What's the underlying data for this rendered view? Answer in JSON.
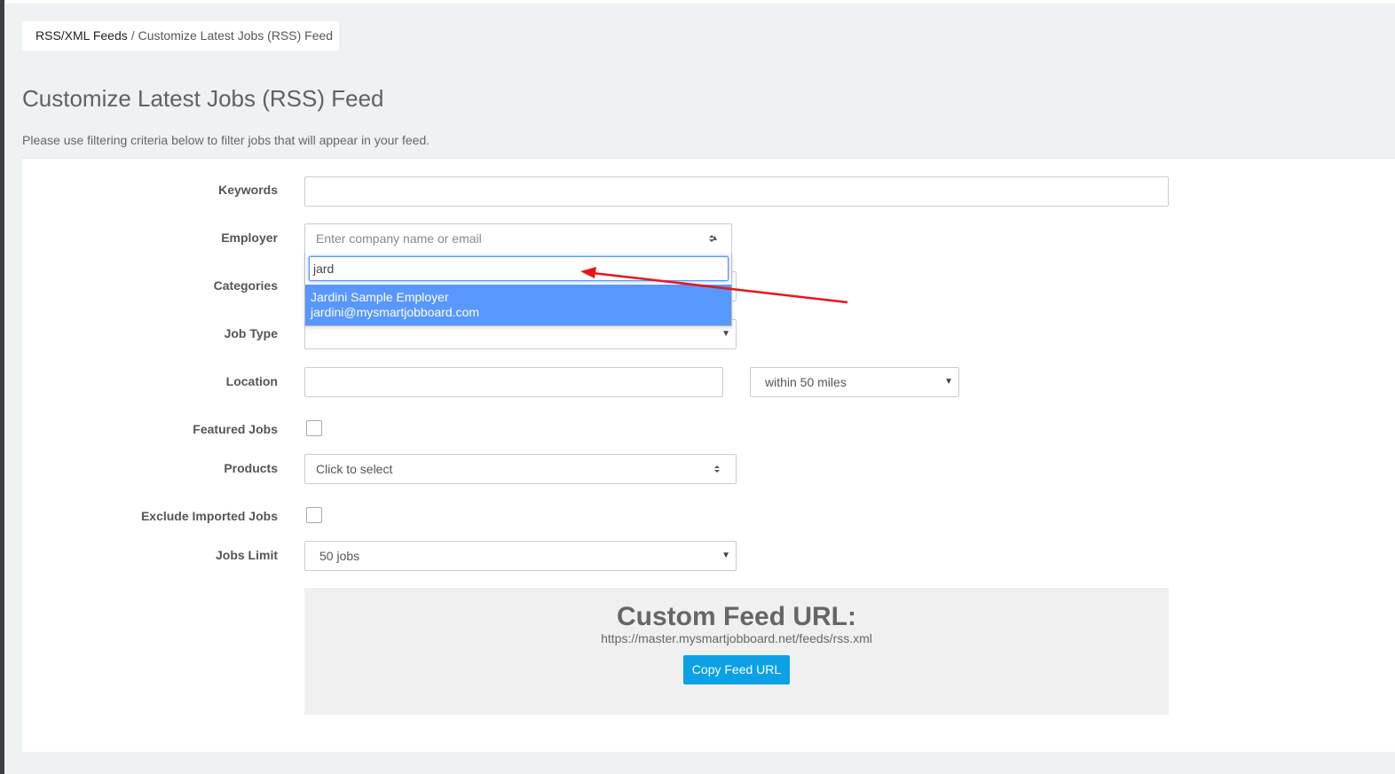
{
  "breadcrumb": {
    "parent": "RSS/XML Feeds",
    "separator": "/",
    "current": "Customize Latest Jobs (RSS) Feed"
  },
  "page": {
    "title": "Customize Latest Jobs (RSS) Feed",
    "description": "Please use filtering criteria below to filter jobs that will appear in your feed."
  },
  "form": {
    "keywords": {
      "label": "Keywords",
      "value": ""
    },
    "employer": {
      "label": "Employer",
      "placeholder": "Enter company name or email",
      "search_value": "jard",
      "option_name": "Jardini Sample Employer",
      "option_email": "jardini@mysmartjobboard.com"
    },
    "categories": {
      "label": "Categories"
    },
    "job_type": {
      "label": "Job Type"
    },
    "location": {
      "label": "Location",
      "value": "",
      "radius": "within 50 miles"
    },
    "featured": {
      "label": "Featured Jobs"
    },
    "products": {
      "label": "Products",
      "placeholder": "Click to select"
    },
    "exclude_imported": {
      "label": "Exclude Imported Jobs"
    },
    "jobs_limit": {
      "label": "Jobs Limit",
      "value": "50 jobs"
    }
  },
  "feed": {
    "title": "Custom Feed URL:",
    "url": "https://master.mysmartjobboard.net/feeds/rss.xml",
    "copy_label": "Copy Feed URL"
  },
  "colors": {
    "accent": "#0aa1e6",
    "highlight": "#5897fb",
    "annotation_arrow": "#e8151b"
  }
}
